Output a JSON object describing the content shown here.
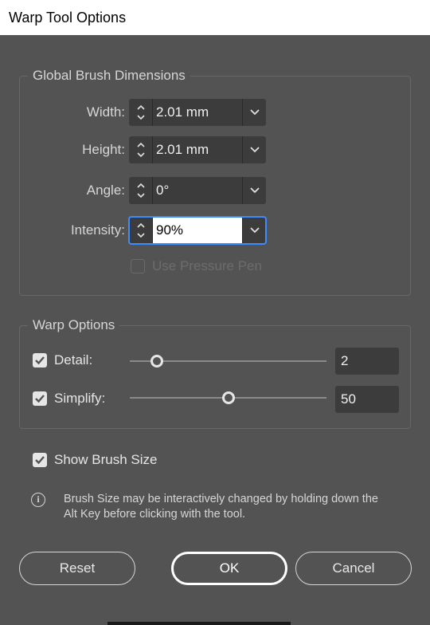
{
  "window": {
    "title": "Warp Tool Options"
  },
  "global_brush": {
    "title": "Global Brush Dimensions",
    "width": {
      "label": "Width:",
      "value": "2.01 mm"
    },
    "height": {
      "label": "Height:",
      "value": "2.01 mm"
    },
    "angle": {
      "label": "Angle:",
      "value": "0°"
    },
    "intensity": {
      "label": "Intensity:",
      "value": "90%"
    },
    "pressure_pen": {
      "label": "Use Pressure Pen",
      "checked": false,
      "enabled": false
    }
  },
  "warp_options": {
    "title": "Warp Options",
    "detail": {
      "label": "Detail:",
      "checked": true,
      "value": "2",
      "slider_fraction": 0.14
    },
    "simplify": {
      "label": "Simplify:",
      "checked": true,
      "value": "50",
      "slider_fraction": 0.5
    }
  },
  "show_brush_size": {
    "label": "Show Brush Size",
    "checked": true
  },
  "info": {
    "icon": "info-icon",
    "line1": "Brush Size may be interactively changed by holding down the",
    "line2": "Alt Key before clicking with the tool."
  },
  "buttons": {
    "reset": "Reset",
    "ok": "OK",
    "cancel": "Cancel"
  },
  "colors": {
    "background": "#535353",
    "field": "#3c3c3c",
    "focus": "#3c8cff"
  }
}
